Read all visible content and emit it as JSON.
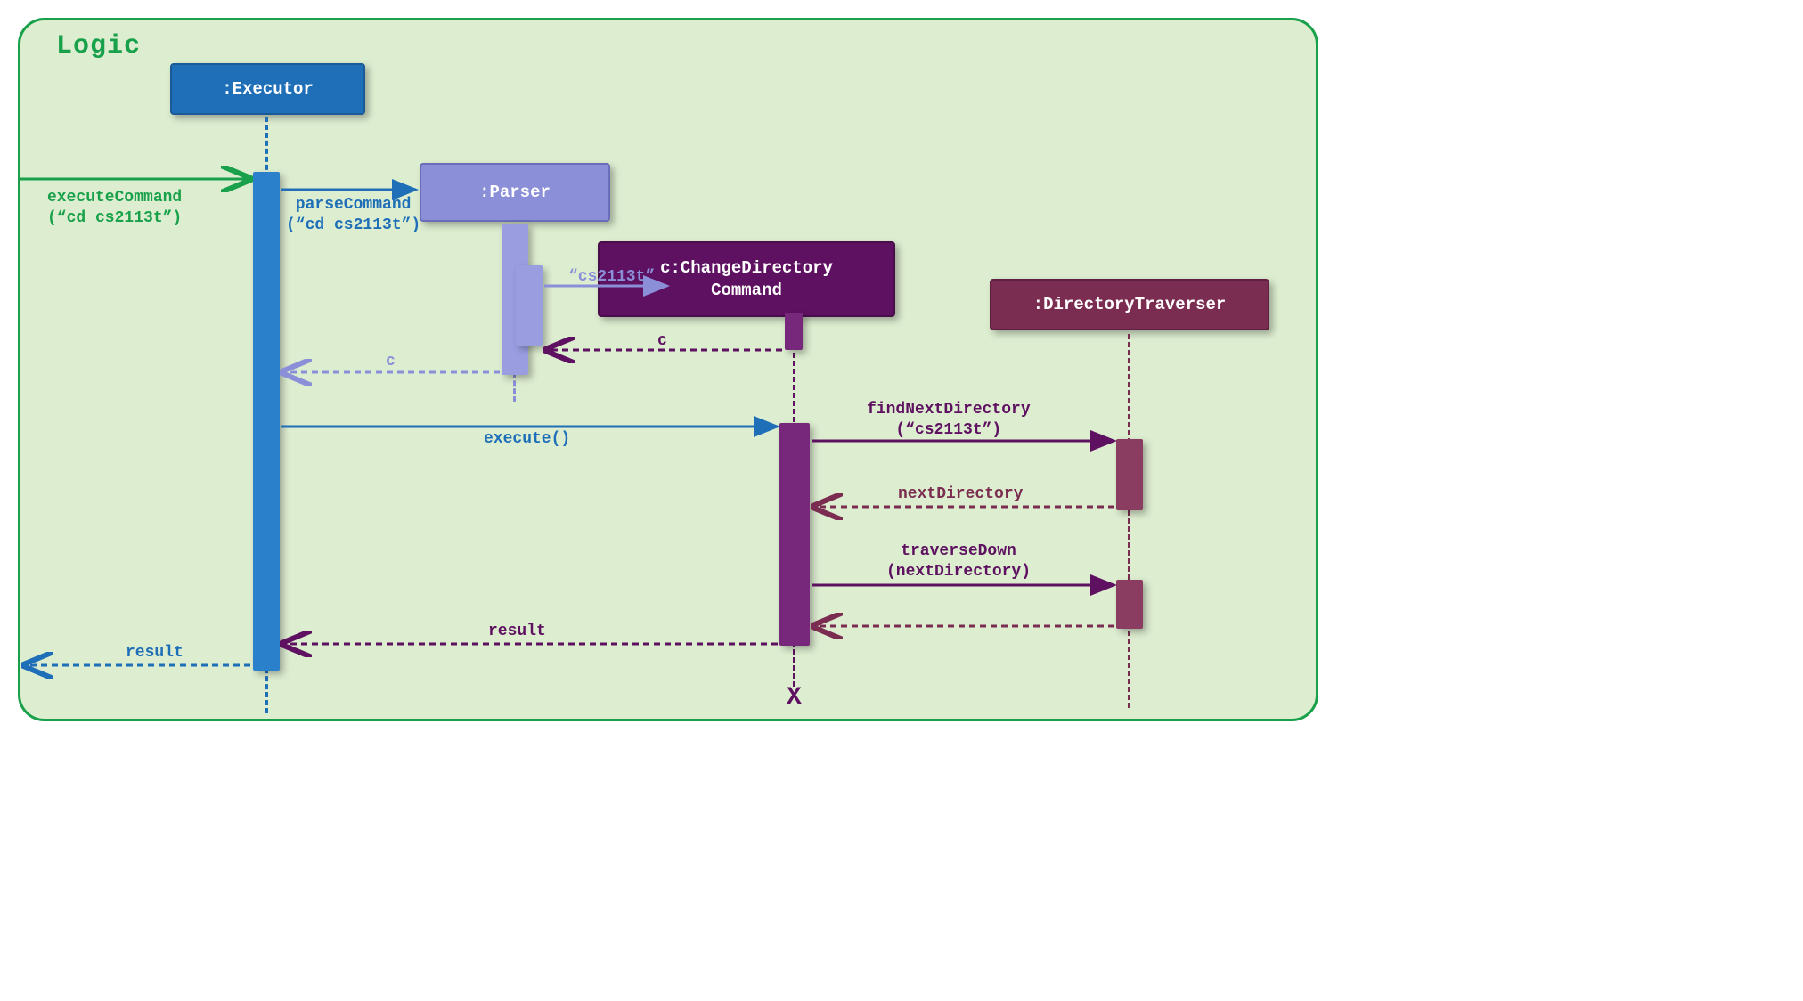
{
  "frame": {
    "label": "Logic"
  },
  "participants": {
    "executor": ":Executor",
    "parser": ":Parser",
    "command": "c:ChangeDirectory\nCommand",
    "traverser": ":DirectoryTraverser"
  },
  "messages": {
    "executeCommand": "executeCommand\n(“cd cs2113t”)",
    "parseCommand": "parseCommand\n(“cd cs2113t”)",
    "createCmd": "“cs2113t”",
    "return_c1": "c",
    "return_c2": "c",
    "execute": "execute()",
    "findNext": "findNextDirectory\n(“cs2113t”)",
    "nextDir": "nextDirectory",
    "traverseDown": "traverseDown\n(nextDirectory)",
    "result1": "result",
    "result2": "result"
  },
  "destroy": "X",
  "colors": {
    "green": "#18a14a",
    "frameBg": "#ddedd0",
    "blue": "#1e6fb8",
    "purple": "#8b8fd8",
    "violet": "#5e1160",
    "maroon": "#7a2d50",
    "activationBlue": "#2b80cc",
    "activationPurple": "#9a9de0",
    "activationViolet": "#78287a",
    "activationMaroon": "#8a3d60"
  }
}
